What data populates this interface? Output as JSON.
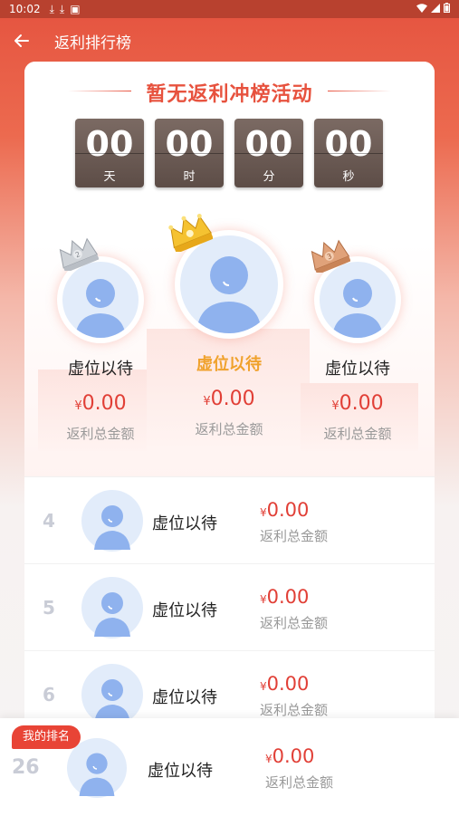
{
  "status_bar": {
    "time": "10:02"
  },
  "header": {
    "title": "返利排行榜",
    "back_icon": "arrow-left-icon"
  },
  "banner": {
    "title": "暂无返利冲榜活动"
  },
  "countdown": [
    {
      "value": "00",
      "unit": "天"
    },
    {
      "value": "00",
      "unit": "时"
    },
    {
      "value": "00",
      "unit": "分"
    },
    {
      "value": "00",
      "unit": "秒"
    }
  ],
  "top3": [
    {
      "rank": "2",
      "name": "虚位以待",
      "currency": "¥",
      "amount": "0.00",
      "label": "返利总金额",
      "crown": "silver-crown-icon"
    },
    {
      "rank": "1",
      "name": "虚位以待",
      "currency": "¥",
      "amount": "0.00",
      "label": "返利总金额",
      "crown": "gold-crown-icon"
    },
    {
      "rank": "3",
      "name": "虚位以待",
      "currency": "¥",
      "amount": "0.00",
      "label": "返利总金额",
      "crown": "bronze-crown-icon"
    }
  ],
  "list": [
    {
      "rank": "4",
      "name": "虚位以待",
      "currency": "¥",
      "amount": "0.00",
      "label": "返利总金额"
    },
    {
      "rank": "5",
      "name": "虚位以待",
      "currency": "¥",
      "amount": "0.00",
      "label": "返利总金额"
    },
    {
      "rank": "6",
      "name": "虚位以待",
      "currency": "¥",
      "amount": "0.00",
      "label": "返利总金额"
    }
  ],
  "my_rank": {
    "badge": "我的排名",
    "rank": "26",
    "name": "虚位以待",
    "currency": "¥",
    "amount": "0.00",
    "label": "返利总金额"
  },
  "colors": {
    "primary": "#e5533f",
    "amount": "#e13f36",
    "gold_name": "#f0a22d",
    "countdown_box": "#5d4d47"
  }
}
